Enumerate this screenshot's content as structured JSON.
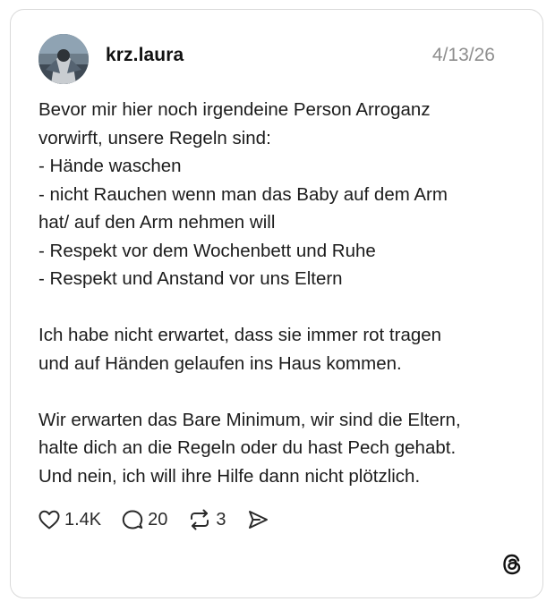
{
  "post": {
    "author": {
      "username": "krz.laura",
      "avatar_icon": "avatar-photo"
    },
    "date": "4/13/26",
    "body_lines": [
      "Bevor mir hier noch irgendeine Person Arroganz",
      "vorwirft, unsere Regeln sind:",
      "- Hände waschen",
      "- nicht Rauchen wenn man das Baby auf dem Arm",
      "hat/ auf den Arm nehmen will",
      "- Respekt vor dem Wochenbett und Ruhe",
      "- Respekt und Anstand vor uns Eltern",
      "",
      "Ich habe nicht erwartet, dass sie immer rot tragen",
      "und auf Händen gelaufen ins Haus kommen.",
      "",
      "Wir erwarten das Bare Minimum, wir sind die Eltern,",
      "halte dich an die Regeln oder du hast Pech gehabt.",
      "Und nein, ich will ihre Hilfe dann nicht plötzlich."
    ],
    "actions": {
      "likes": "1.4K",
      "replies": "20",
      "reposts": "3"
    }
  },
  "icons": {
    "like": "heart-icon",
    "reply": "comment-icon",
    "repost": "repost-icon",
    "share": "send-icon",
    "brand": "threads-logo-icon"
  },
  "colors": {
    "border": "#d9d9d9",
    "text": "#1c1c1c",
    "muted": "#8e8e8e"
  }
}
